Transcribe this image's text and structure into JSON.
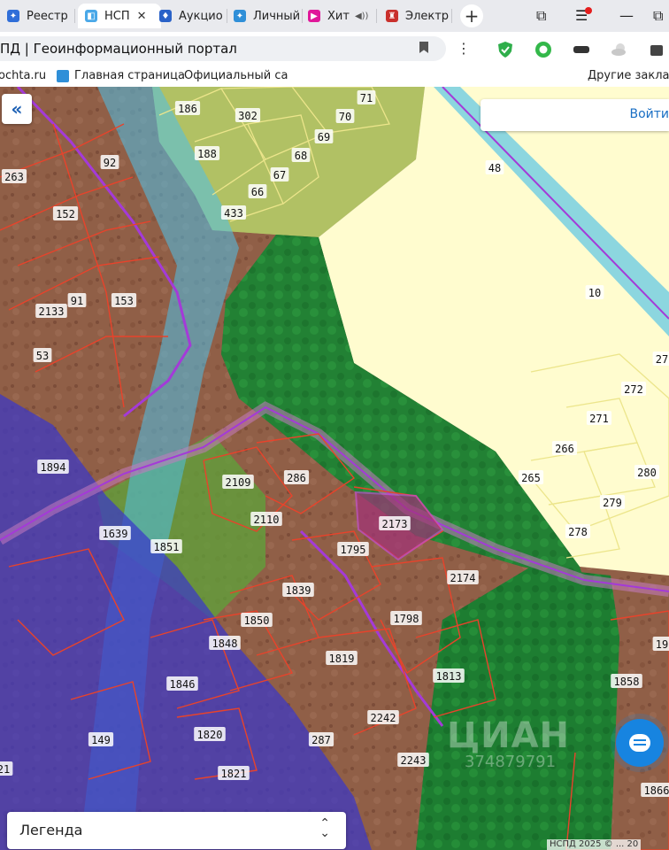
{
  "browser": {
    "tabs": [
      {
        "label": "Реестр",
        "icon": "shield-icon",
        "active": false
      },
      {
        "label": "НСП",
        "icon": "page-icon",
        "active": true
      },
      {
        "label": "Аукцио",
        "icon": "crest-icon",
        "active": false
      },
      {
        "label": "Личный",
        "icon": "shield-icon",
        "active": false
      },
      {
        "label": "Хит",
        "icon": "play-icon",
        "active": false
      },
      {
        "label": "Электр",
        "icon": "tower-icon",
        "active": false
      }
    ],
    "page_title": "ПД | Геоинформационный портал",
    "bookmarks": [
      "ochta.ru",
      "Главная страница",
      "Официальный сайт"
    ],
    "other_bookmarks": "Другие закладки"
  },
  "map": {
    "back_button": "«",
    "login_button": "Войти",
    "legend_label": "Легенда",
    "watermark": "ЦИАН",
    "watermark_id": "374879791",
    "copyright": "НСПД 2025 © ... 20",
    "parcels": [
      "186",
      "302",
      "71",
      "70",
      "69",
      "188",
      "68",
      "67",
      "66",
      "433",
      "92",
      "263",
      "152",
      "48",
      "91",
      "153",
      "2133",
      "53",
      "10",
      "27",
      "272",
      "271",
      "266",
      "1894",
      "2109",
      "286",
      "265",
      "280",
      "279",
      "2110",
      "2173",
      "278",
      "1639",
      "1851",
      "1795",
      "2174",
      "1839",
      "1798",
      "1850",
      "1848",
      "1819",
      "1813",
      "1846",
      "1858",
      "19",
      "1820",
      "287",
      "2242",
      "149",
      "2243",
      "1821",
      "1866",
      "21"
    ],
    "colors": {
      "parcel_border": "#e8432b",
      "agri_zone": "#fffccf",
      "forest_zone": "#1f8f2e",
      "water_zone": "#5fc9e6",
      "protected_zone": "#4b3ed6",
      "road_line": "#a43ad8"
    }
  }
}
